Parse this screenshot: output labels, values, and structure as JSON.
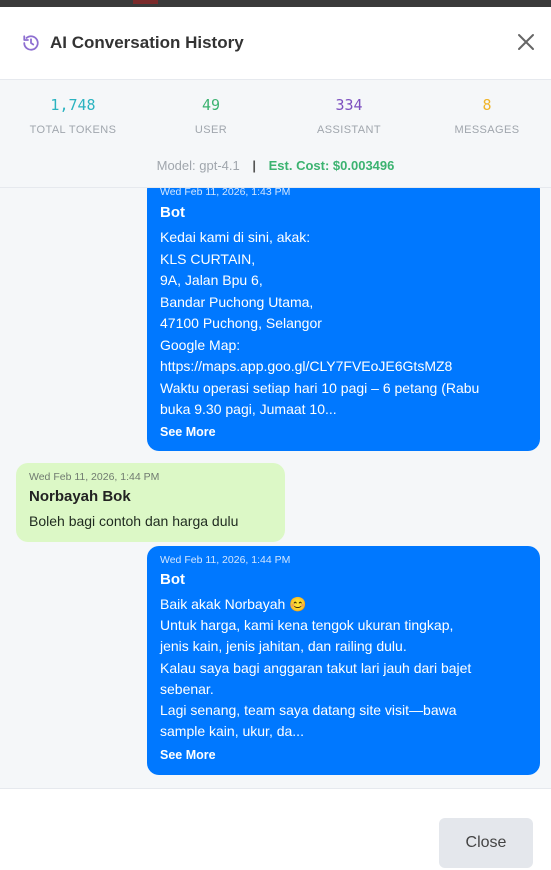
{
  "header": {
    "title": "AI Conversation History",
    "icon": "history-icon",
    "close_icon": "close-icon"
  },
  "stats": [
    {
      "value": "1,748",
      "label": "TOTAL TOKENS",
      "color": "#2bb3c0"
    },
    {
      "value": "49",
      "label": "USER",
      "color": "#3cb371"
    },
    {
      "value": "334",
      "label": "ASSISTANT",
      "color": "#7d4fbf"
    },
    {
      "value": "8",
      "label": "MESSAGES",
      "color": "#f0b429"
    }
  ],
  "meta": {
    "model": "Model: gpt-4.1",
    "separator": "|",
    "cost": "Est. Cost: $0.003496",
    "cost_color": "#3cb371"
  },
  "messages": [
    {
      "role": "bot",
      "timestamp": "Wed Feb 11, 2026, 1:43 PM",
      "sender": "Bot",
      "lines": [
        "Kedai kami di sini, akak:",
        "KLS CURTAIN,",
        "9A, Jalan Bpu 6,",
        "Bandar Puchong Utama,",
        "47100 Puchong, Selangor",
        "Google Map:",
        "https://maps.app.goo.gl/CLY7FVEoJE6GtsMZ8",
        "Waktu operasi setiap hari 10 pagi – 6 petang (Rabu",
        "buka 9.30 pagi, Jumaat 10..."
      ],
      "see_more": "See More"
    },
    {
      "role": "user",
      "timestamp": "Wed Feb 11, 2026, 1:44 PM",
      "sender": "Norbayah Bok",
      "lines": [
        "Boleh bagi contoh dan harga dulu"
      ]
    },
    {
      "role": "bot",
      "timestamp": "Wed Feb 11, 2026, 1:44 PM",
      "sender": "Bot",
      "lines": [
        "Baik akak Norbayah 😊",
        "Untuk harga, kami kena tengok ukuran tingkap,",
        "jenis kain, jenis jahitan, dan railing dulu.",
        "Kalau saya bagi anggaran takut lari jauh dari bajet",
        "sebenar.",
        "Lagi senang, team saya datang site visit—bawa",
        "sample kain, ukur, da..."
      ],
      "see_more": "See More"
    }
  ],
  "footer": {
    "close_label": "Close"
  }
}
